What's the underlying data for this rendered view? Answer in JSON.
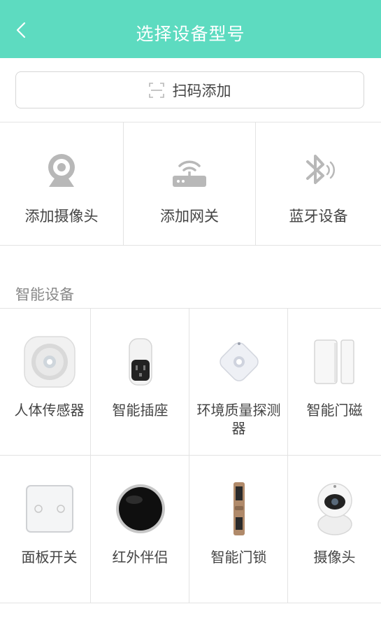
{
  "header": {
    "title": "选择设备型号"
  },
  "scan": {
    "label": "扫码添加"
  },
  "options": [
    {
      "label": "添加摄像头",
      "icon": "webcam-icon"
    },
    {
      "label": "添加网关",
      "icon": "router-icon"
    },
    {
      "label": "蓝牙设备",
      "icon": "bluetooth-icon"
    }
  ],
  "section": {
    "title": "智能设备"
  },
  "devices": [
    {
      "name": "人体传感器",
      "icon": "motion-sensor-image"
    },
    {
      "name": "智能插座",
      "icon": "smart-plug-image"
    },
    {
      "name": "环境质量探测器",
      "icon": "air-quality-detector-image"
    },
    {
      "name": "智能门磁",
      "icon": "door-sensor-image"
    },
    {
      "name": "面板开关",
      "icon": "panel-switch-image"
    },
    {
      "name": "红外伴侣",
      "icon": "ir-companion-image"
    },
    {
      "name": "智能门锁",
      "icon": "smart-lock-image"
    },
    {
      "name": "摄像头",
      "icon": "camera-image"
    }
  ],
  "colors": {
    "accent": "#5ddbc0",
    "icon_gray": "#b8b8b8",
    "divider": "#e3e3e3"
  }
}
